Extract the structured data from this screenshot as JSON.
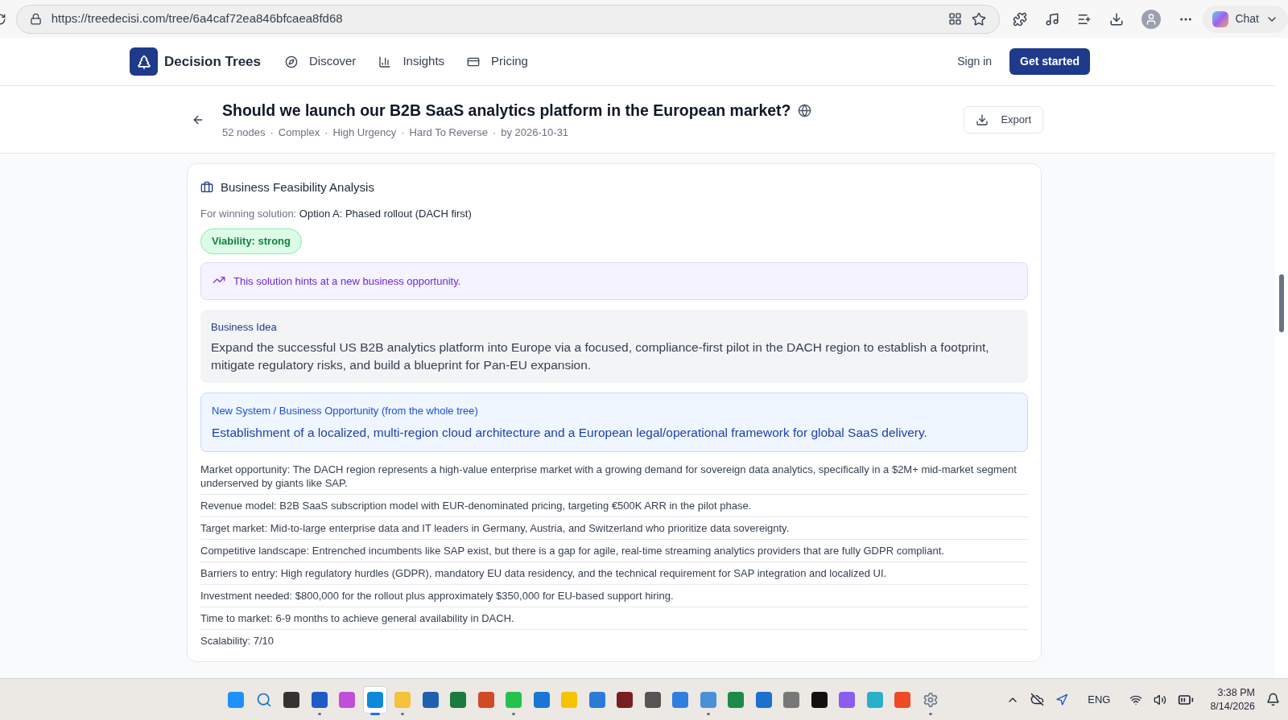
{
  "browser": {
    "url": "https://treedecisi.com/tree/6a4caf72ea846bfcaea8fd68",
    "chat_label": "Chat"
  },
  "nav": {
    "brand": "Decision Trees",
    "links": [
      {
        "label": "Discover",
        "kind": "compass"
      },
      {
        "label": "Insights",
        "kind": "chart"
      },
      {
        "label": "Pricing",
        "kind": "card"
      }
    ],
    "sign_in": "Sign in",
    "cta": "Get started"
  },
  "header": {
    "title": "Should we launch our B2B SaaS analytics platform in the European market?",
    "meta": [
      "52 nodes",
      "·",
      "Complex",
      "·",
      "High Urgency",
      "·",
      "Hard To Reverse",
      "·",
      "by 2026-10-31"
    ],
    "export": "Export"
  },
  "card": {
    "title": "Business Feasibility Analysis",
    "winning_label": "For winning solution:",
    "winning_value": "Option A: Phased rollout (DACH first)",
    "viability": "Viability: strong",
    "hint": "This solution hints at a new business opportunity.",
    "idea": {
      "label": "Business Idea",
      "text": "Expand the successful US B2B analytics platform into Europe via a focused, compliance-first pilot in the DACH region to establish a footprint, mitigate regulatory risks, and build a blueprint for Pan-EU expansion."
    },
    "opportunity": {
      "label": "New System / Business Opportunity (from the whole tree)",
      "text": "Establishment of a localized, multi-region cloud architecture and a European legal/operational framework for global SaaS delivery."
    },
    "facts": [
      "Market opportunity: The DACH region represents a high-value enterprise market with a growing demand for sovereign data analytics, specifically in a $2M+ mid-market segment underserved by giants like SAP.",
      "Revenue model: B2B SaaS subscription model with EUR-denominated pricing, targeting €500K ARR in the pilot phase.",
      "Target market: Mid-to-large enterprise data and IT leaders in Germany, Austria, and Switzerland who prioritize data sovereignty.",
      "Competitive landscape: Entrenched incumbents like SAP exist, but there is a gap for agile, real-time streaming analytics providers that are fully GDPR compliant.",
      "Barriers to entry: High regulatory hurdles (GDPR), mandatory EU data residency, and the technical requirement for SAP integration and localized UI.",
      "Investment needed: $800,000 for the rollout plus approximately $350,000 for EU-based support hiring.",
      "Time to market: 6-9 months to achieve general availability in DACH.",
      "Scalability: 7/10"
    ]
  },
  "taskbar": {
    "apps": [
      {
        "kind": "start",
        "running": false,
        "selected": false
      },
      {
        "kind": "search",
        "running": false,
        "selected": false
      },
      {
        "kind": "taskview",
        "running": false,
        "selected": false
      },
      {
        "kind": "word",
        "running": true,
        "selected": false
      },
      {
        "kind": "m365",
        "running": false,
        "selected": false
      },
      {
        "kind": "edge",
        "running": true,
        "selected": true
      },
      {
        "kind": "folder",
        "running": true,
        "selected": false
      },
      {
        "kind": "store",
        "running": false,
        "selected": false
      },
      {
        "kind": "excel",
        "running": false,
        "selected": false
      },
      {
        "kind": "powerpoint",
        "running": false,
        "selected": false
      },
      {
        "kind": "whatsapp",
        "running": true,
        "selected": false
      },
      {
        "kind": "outlook",
        "running": false,
        "selected": false
      },
      {
        "kind": "notes",
        "running": false,
        "selected": false
      },
      {
        "kind": "editor",
        "running": false,
        "selected": false
      },
      {
        "kind": "notepad",
        "running": false,
        "selected": false
      },
      {
        "kind": "ink",
        "running": false,
        "selected": false
      },
      {
        "kind": "photos",
        "running": false,
        "selected": false
      },
      {
        "kind": "notepad2",
        "running": true,
        "selected": false
      },
      {
        "kind": "cards",
        "running": false,
        "selected": false
      },
      {
        "kind": "azure",
        "running": false,
        "selected": false
      },
      {
        "kind": "device",
        "running": false,
        "selected": false
      },
      {
        "kind": "pycharm",
        "running": false,
        "selected": false
      },
      {
        "kind": "copilot",
        "running": false,
        "selected": false
      },
      {
        "kind": "display",
        "running": false,
        "selected": false
      },
      {
        "kind": "brave",
        "running": false,
        "selected": false
      },
      {
        "kind": "settings",
        "running": true,
        "selected": false
      }
    ],
    "language": "ENG",
    "time": "3:38 PM",
    "date": "8/14/2026"
  }
}
